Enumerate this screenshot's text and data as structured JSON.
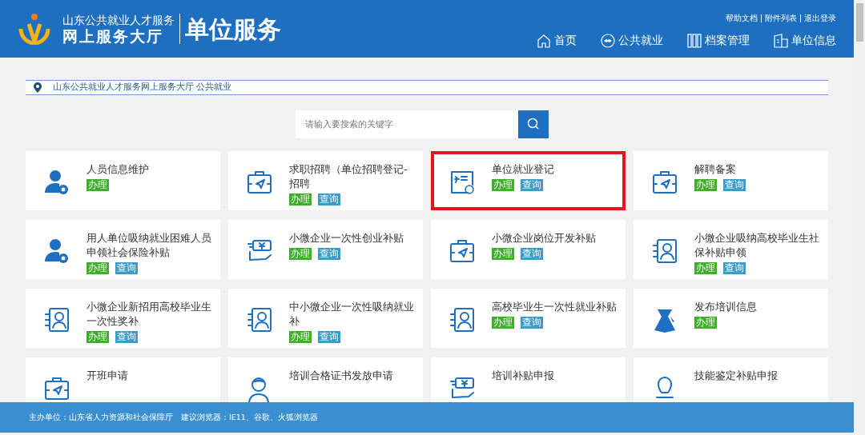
{
  "header": {
    "logo_top": "山东公共就业人才服务",
    "logo_bottom": "网上服务大厅",
    "section_title": "单位服务",
    "top_links": [
      "帮助文档",
      "附件列表",
      "退出登录"
    ],
    "nav": [
      {
        "label": "首页"
      },
      {
        "label": "公共就业"
      },
      {
        "label": "档案管理"
      },
      {
        "label": "单位信息"
      }
    ]
  },
  "breadcrumb": "山东公共就业人才服务网上服务大厅 公共就业",
  "search": {
    "placeholder": "请输入要搜索的关键字"
  },
  "services": [
    {
      "title": "人员信息维护",
      "highlighted": false,
      "actions": [
        {
          "label": "办理",
          "kind": "handle"
        }
      ]
    },
    {
      "title": "求职招聘（单位招聘登记-招聘",
      "highlighted": false,
      "actions": [
        {
          "label": "办理",
          "kind": "handle"
        },
        {
          "label": "查询",
          "kind": "query"
        }
      ]
    },
    {
      "title": "单位就业登记",
      "highlighted": true,
      "actions": [
        {
          "label": "办理",
          "kind": "handle"
        },
        {
          "label": "查询",
          "kind": "query"
        }
      ]
    },
    {
      "title": "解聘备案",
      "highlighted": false,
      "actions": [
        {
          "label": "办理",
          "kind": "handle"
        },
        {
          "label": "查询",
          "kind": "query"
        }
      ]
    },
    {
      "title": "用人单位吸纳就业困难人员申领社会保险补贴",
      "highlighted": false,
      "actions": [
        {
          "label": "办理",
          "kind": "handle"
        },
        {
          "label": "查询",
          "kind": "query"
        }
      ]
    },
    {
      "title": "小微企业一次性创业补贴",
      "highlighted": false,
      "actions": [
        {
          "label": "办理",
          "kind": "handle"
        },
        {
          "label": "查询",
          "kind": "query"
        }
      ]
    },
    {
      "title": "小微企业岗位开发补贴",
      "highlighted": false,
      "actions": [
        {
          "label": "办理",
          "kind": "handle"
        },
        {
          "label": "查询",
          "kind": "query"
        }
      ]
    },
    {
      "title": "小微企业吸纳高校毕业生社保补贴申领",
      "highlighted": false,
      "actions": [
        {
          "label": "办理",
          "kind": "handle"
        },
        {
          "label": "查询",
          "kind": "query"
        }
      ]
    },
    {
      "title": "小微企业新招用高校毕业生一次性奖补",
      "highlighted": false,
      "actions": [
        {
          "label": "办理",
          "kind": "handle"
        },
        {
          "label": "查询",
          "kind": "query"
        }
      ]
    },
    {
      "title": "中小微企业一次性吸纳就业补",
      "highlighted": false,
      "actions": [
        {
          "label": "办理",
          "kind": "handle"
        },
        {
          "label": "查询",
          "kind": "query"
        }
      ]
    },
    {
      "title": "高校毕业生一次性就业补贴",
      "highlighted": false,
      "actions": [
        {
          "label": "办理",
          "kind": "handle"
        },
        {
          "label": "查询",
          "kind": "query"
        }
      ]
    },
    {
      "title": "发布培训信息",
      "highlighted": false,
      "actions": [
        {
          "label": "办理",
          "kind": "handle"
        }
      ]
    },
    {
      "title": "开班申请",
      "highlighted": false
    },
    {
      "title": "培训合格证书发放申请",
      "highlighted": false
    },
    {
      "title": "培训补贴申报",
      "highlighted": false
    },
    {
      "title": "技能鉴定补贴申报",
      "highlighted": false
    }
  ],
  "footer": {
    "organizer": "主办单位：山东省人力资源和社会保障厅",
    "browsers": "建议浏览器：IE11、谷歌、火狐浏览器"
  }
}
